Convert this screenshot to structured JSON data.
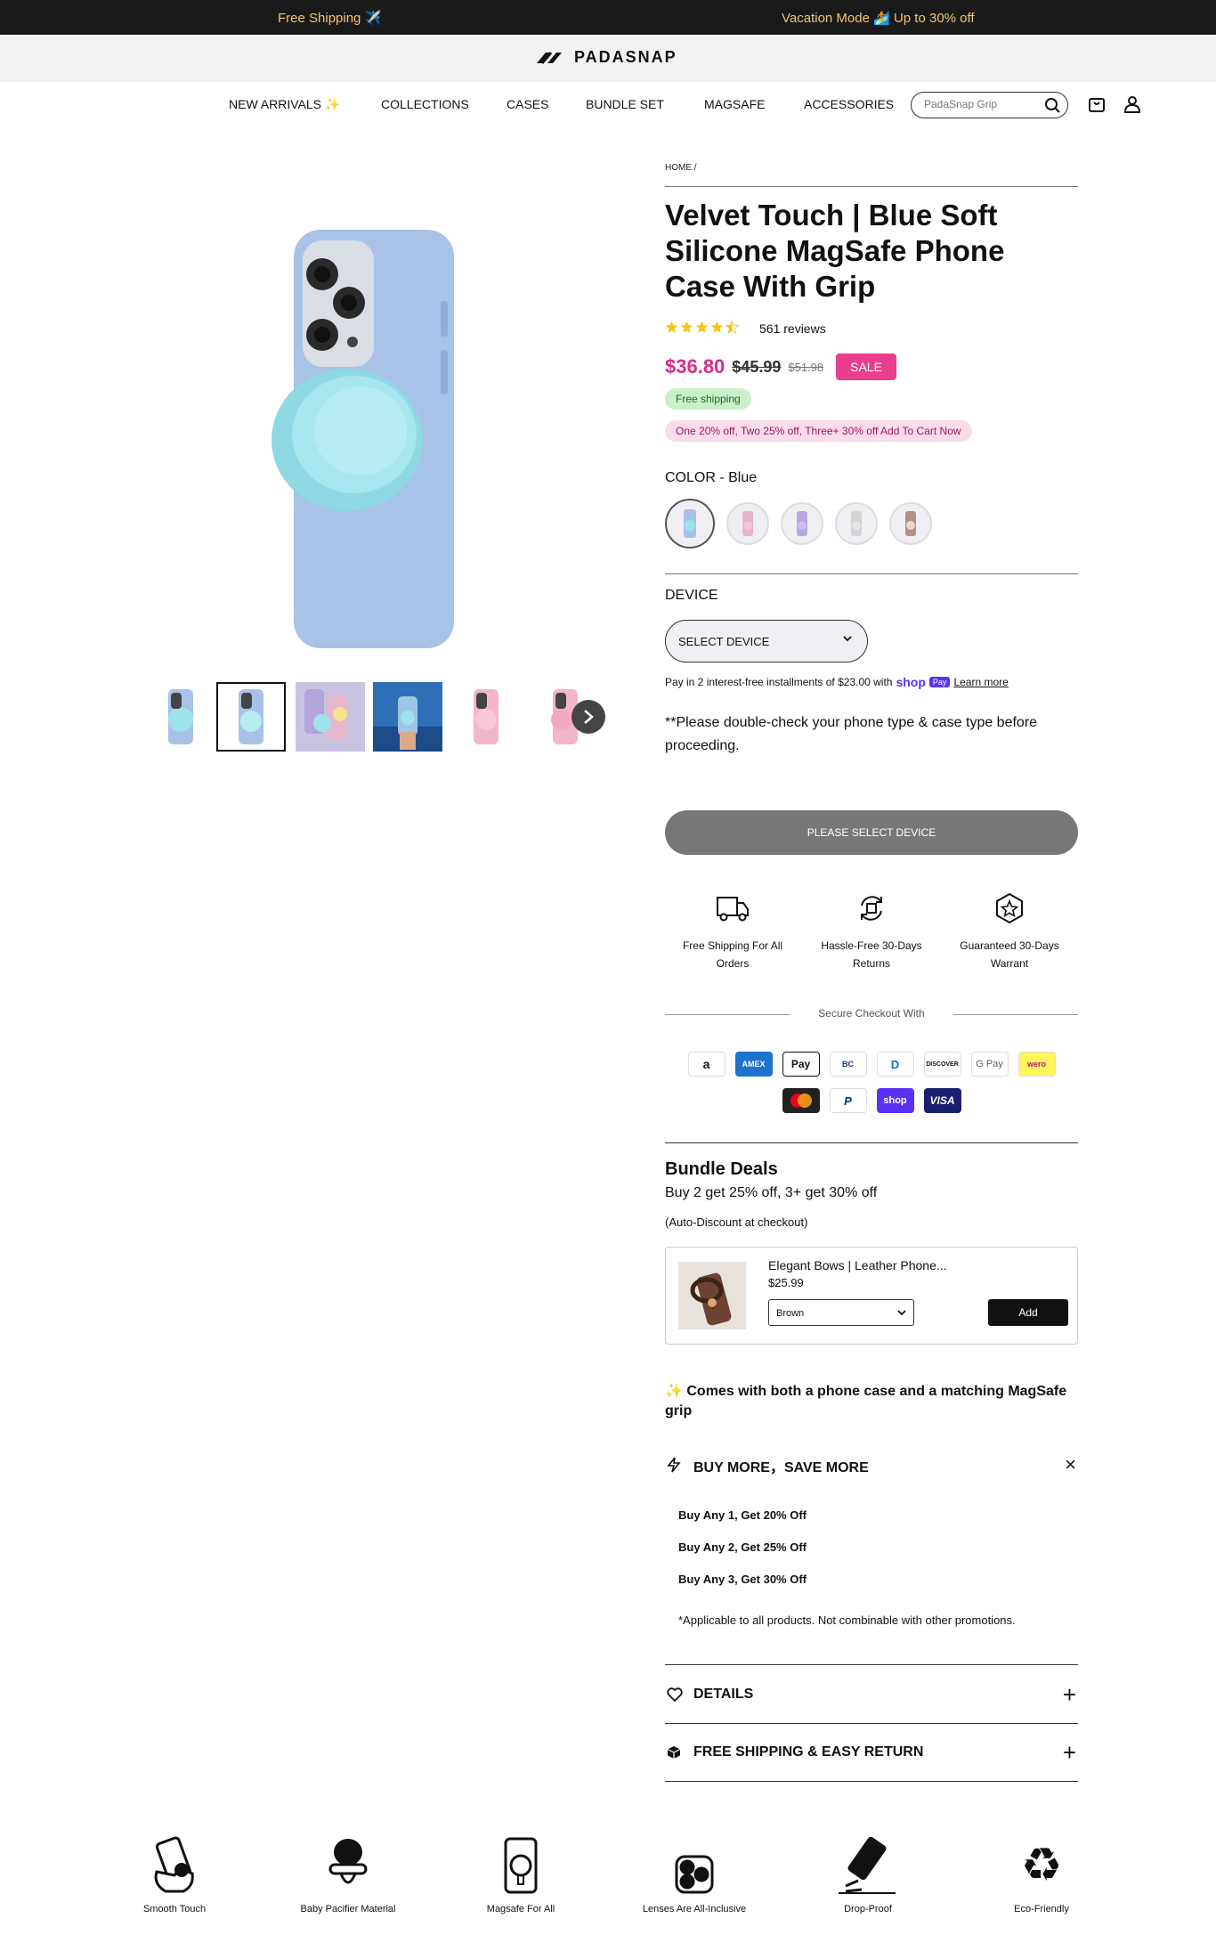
{
  "announcement": {
    "left": "Free Shipping ✈️",
    "right": "Vacation Mode 🏄 Up to 30% off"
  },
  "brand": {
    "name": "PADASNAP"
  },
  "nav": {
    "items": [
      "NEW ARRIVALS ✨",
      "COLLECTIONS",
      "CASES",
      "BUNDLE SET",
      "MAGSAFE",
      "ACCESSORIES"
    ],
    "search_placeholder": "PadaSnap Grip",
    "cart_icon": "bag-icon",
    "account_icon": "user-icon"
  },
  "breadcrumb": "HOME /",
  "product": {
    "title": "Velvet Touch | Blue Soft Silicone MagSafe Phone Case With Grip",
    "rating": 4.5,
    "reviews": "561 reviews",
    "price": "$36.80",
    "compare_price": "$45.99",
    "compare_price_2": "$51.98",
    "sale_badge": "SALE",
    "free_shipping_pill": "Free shipping",
    "promo_pill": "One 20% off, Two 25% off, Three+ 30% off Add To Cart Now",
    "color_label": "COLOR - Blue",
    "colors": [
      "Blue",
      "Pink",
      "Purple",
      "Grey",
      "Brown"
    ],
    "selected_color_index": 0,
    "device_label": "DEVICE",
    "device_select": "SELECT DEVICE",
    "installments": {
      "text": "Pay in 2 interest-free installments of $23.00 with",
      "shop": "shop",
      "pay": "Pay",
      "learn": "Learn more"
    },
    "note": "**Please double-check your phone type & case type before proceeding.",
    "cta": "PLEASE SELECT DEVICE"
  },
  "gallery": {
    "thumb_count": 6,
    "selected_thumb": 1
  },
  "perks": [
    {
      "icon": "truck-icon",
      "label": "Free Shipping For All Orders"
    },
    {
      "icon": "return-icon",
      "label": "Hassle-Free 30-Days Returns"
    },
    {
      "icon": "badge-star-icon",
      "label": "Guaranteed 30-Days Warrant"
    }
  ],
  "secure_checkout": "Secure Checkout With",
  "payments_row1": [
    "a",
    "AMEX",
    "Pay",
    "BC",
    "D",
    "DISCOVER",
    "G Pay",
    "wero"
  ],
  "payments_row2": [
    "MC",
    "P",
    "shop",
    "VISA"
  ],
  "bundle": {
    "title": "Bundle Deals",
    "subtitle": "Buy 2 get 25% off, 3+ get 30% off",
    "note": "(Auto-Discount at checkout)",
    "item_name": "Elegant Bows | Leather Phone...",
    "item_price": "$25.99",
    "item_option": "Brown",
    "add_label": "Add"
  },
  "comes_with": "✨ Comes with both a phone case and a matching MagSafe grip",
  "buy_more": {
    "title": "BUY MORE，SAVE MORE",
    "lines": [
      "Buy Any 1, Get 20% Off",
      "Buy Any 2, Get 25% Off",
      "Buy Any 3, Get 30% Off"
    ],
    "footnote": "*Applicable to all products. Not combinable with other promotions."
  },
  "accordions": [
    {
      "icon": "heart-icon",
      "title": "DETAILS"
    },
    {
      "icon": "box-icon",
      "title": "FREE SHIPPING & EASY RETURN"
    }
  ],
  "features": [
    {
      "icon": "smooth-touch-icon",
      "label": "Smooth Touch"
    },
    {
      "icon": "pacifier-icon",
      "label": "Baby Pacifier Material"
    },
    {
      "icon": "magsafe-icon",
      "label": "Magsafe For All"
    },
    {
      "icon": "lens-icon",
      "label": "Lenses Are All-Inclusive"
    },
    {
      "icon": "drop-icon",
      "label": "Drop-Proof"
    },
    {
      "icon": "recycle-icon",
      "label": "Eco-Friendly"
    }
  ],
  "colors": {
    "accent_pink": "#d92c8a",
    "sale_bg": "#e83e8c",
    "topbar_bg": "#1a1a1a",
    "topbar_text": "#f2c36b",
    "case_blue": "#a9c2e8",
    "grip_teal": "#9fe3ea"
  }
}
